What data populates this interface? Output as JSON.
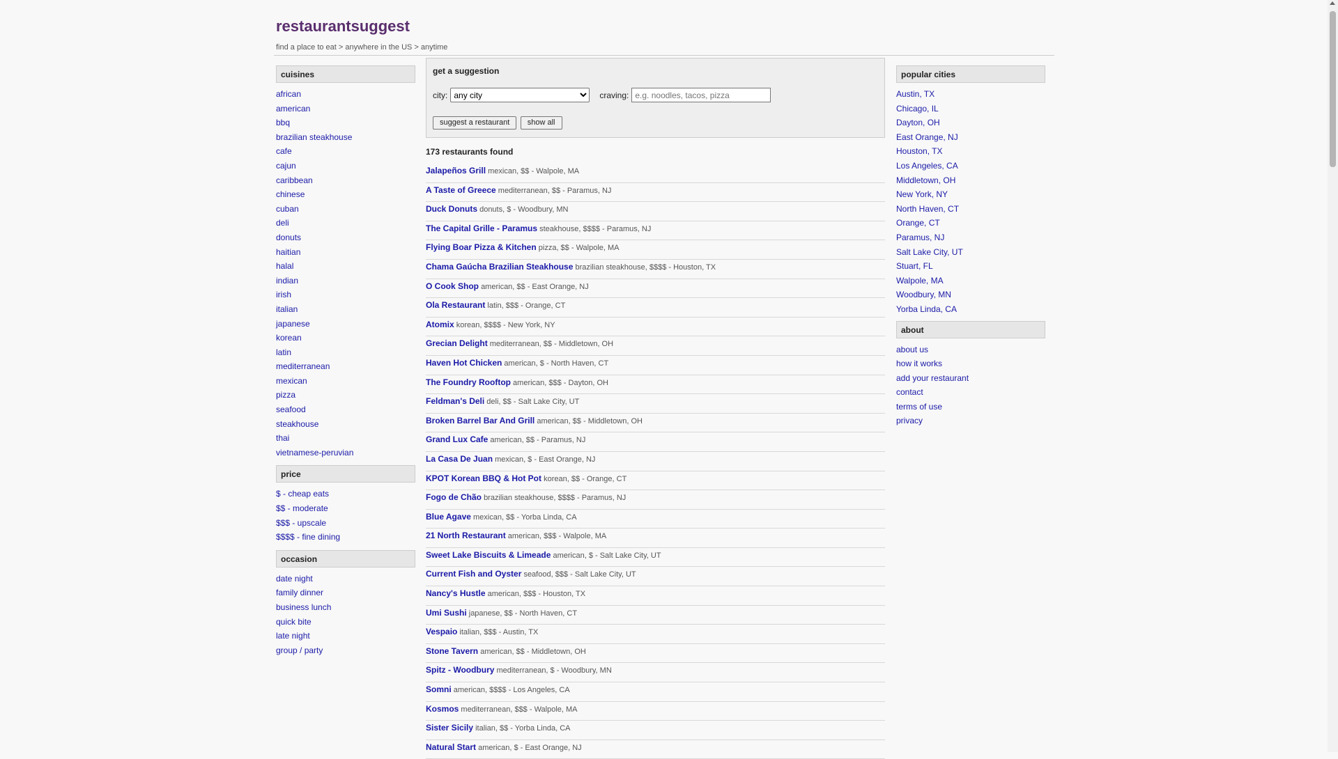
{
  "site": {
    "title": "restaurantsuggest",
    "breadcrumb": "find a place to eat > anywhere in the US > anytime"
  },
  "sidebar": {
    "cuisines": {
      "heading": "cuisines",
      "items": [
        "african",
        "american",
        "bbq",
        "brazilian steakhouse",
        "cafe",
        "cajun",
        "caribbean",
        "chinese",
        "cuban",
        "deli",
        "donuts",
        "haitian",
        "halal",
        "indian",
        "irish",
        "italian",
        "japanese",
        "korean",
        "latin",
        "mediterranean",
        "mexican",
        "pizza",
        "seafood",
        "steakhouse",
        "thai",
        "vietnamese-peruvian"
      ]
    },
    "price": {
      "heading": "price",
      "items": [
        "$ - cheap eats",
        "$$ - moderate",
        "$$$ - upscale",
        "$$$$ - fine dining"
      ]
    },
    "occasion": {
      "heading": "occasion",
      "items": [
        "date night",
        "family dinner",
        "business lunch",
        "quick bite",
        "late night",
        "group / party"
      ]
    }
  },
  "suggest": {
    "heading": "get a suggestion",
    "city_label": "city:",
    "city_value": "any city",
    "craving_label": "craving:",
    "craving_placeholder": "e.g. noodles, tacos, pizza",
    "suggest_button": "suggest a restaurant",
    "show_all_button": "show all"
  },
  "results": {
    "count_text": "173 restaurants found",
    "items": [
      {
        "name": "Jalapeños Grill",
        "meta": "mexican, $$ - Walpole, MA"
      },
      {
        "name": "A Taste of Greece",
        "meta": "mediterranean, $$ - Paramus, NJ"
      },
      {
        "name": "Duck Donuts",
        "meta": "donuts, $ - Woodbury, MN"
      },
      {
        "name": "The Capital Grille - Paramus",
        "meta": "steakhouse, $$$$ - Paramus, NJ"
      },
      {
        "name": "Flying Boar Pizza & Kitchen",
        "meta": "pizza, $$ - Walpole, MA"
      },
      {
        "name": "Chama Gaúcha Brazilian Steakhouse",
        "meta": "brazilian steakhouse, $$$$ - Houston, TX"
      },
      {
        "name": "O Cook Shop",
        "meta": "american, $$ - East Orange, NJ"
      },
      {
        "name": "Ola Restaurant",
        "meta": "latin, $$$ - Orange, CT"
      },
      {
        "name": "Atomix",
        "meta": "korean, $$$$ - New York, NY"
      },
      {
        "name": "Grecian Delight",
        "meta": "mediterranean, $$ - Middletown, OH"
      },
      {
        "name": "Haven Hot Chicken",
        "meta": "american, $ - North Haven, CT"
      },
      {
        "name": "The Foundry Rooftop",
        "meta": "american, $$$ - Dayton, OH"
      },
      {
        "name": "Feldman's Deli",
        "meta": "deli, $$ - Salt Lake City, UT"
      },
      {
        "name": "Broken Barrel Bar And Grill",
        "meta": "american, $$ - Middletown, OH"
      },
      {
        "name": "Grand Lux Cafe",
        "meta": "american, $$ - Paramus, NJ"
      },
      {
        "name": "La Casa De Juan",
        "meta": "mexican, $ - East Orange, NJ"
      },
      {
        "name": "KPOT Korean BBQ & Hot Pot",
        "meta": "korean, $$ - Orange, CT"
      },
      {
        "name": "Fogo de Chão",
        "meta": "brazilian steakhouse, $$$$ - Paramus, NJ"
      },
      {
        "name": "Blue Agave",
        "meta": "mexican, $$ - Yorba Linda, CA"
      },
      {
        "name": "21 North Restaurant",
        "meta": "american, $$$ - Walpole, MA"
      },
      {
        "name": "Sweet Lake Biscuits & Limeade",
        "meta": "american, $ - Salt Lake City, UT"
      },
      {
        "name": "Current Fish and Oyster",
        "meta": "seafood, $$$ - Salt Lake City, UT"
      },
      {
        "name": "Nancy's Hustle",
        "meta": "american, $$$ - Houston, TX"
      },
      {
        "name": "Umi Sushi",
        "meta": "japanese, $$ - North Haven, CT"
      },
      {
        "name": "Vespaio",
        "meta": "italian, $$$ - Austin, TX"
      },
      {
        "name": "Stone Tavern",
        "meta": "american, $$ - Middletown, OH"
      },
      {
        "name": "Spitz - Woodbury",
        "meta": "mediterranean, $ - Woodbury, MN"
      },
      {
        "name": "Somni",
        "meta": "american, $$$$ - Los Angeles, CA"
      },
      {
        "name": "Kosmos",
        "meta": "mediterranean, $$$ - Walpole, MA"
      },
      {
        "name": "Sister Sicily",
        "meta": "italian, $$ - Yorba Linda, CA"
      },
      {
        "name": "Natural Start",
        "meta": "american, $ - East Orange, NJ"
      }
    ]
  },
  "right": {
    "cities": {
      "heading": "popular cities",
      "items": [
        "Austin, TX",
        "Chicago, IL",
        "Dayton, OH",
        "East Orange, NJ",
        "Houston, TX",
        "Los Angeles, CA",
        "Middletown, OH",
        "New York, NY",
        "North Haven, CT",
        "Orange, CT",
        "Paramus, NJ",
        "Salt Lake City, UT",
        "Stuart, FL",
        "Walpole, MA",
        "Woodbury, MN",
        "Yorba Linda, CA"
      ]
    },
    "about": {
      "heading": "about",
      "items": [
        "about us",
        "how it works",
        "add your restaurant",
        "contact",
        "terms of use",
        "privacy"
      ]
    }
  },
  "colors": {
    "logo": "#5a2e6e",
    "link": "#1a1aa8",
    "meta": "#555555",
    "section_head_bg": "#e6e6e6"
  },
  "icons": {
    "scroll_up": "triangle-up"
  }
}
